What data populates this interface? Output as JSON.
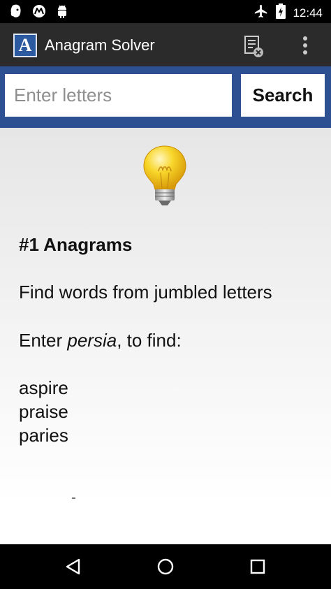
{
  "status_bar": {
    "icons_left": [
      "evernote-icon",
      "motorola-icon",
      "android-icon"
    ],
    "icons_right": [
      "airplane-mode-icon",
      "battery-charging-icon"
    ],
    "time": "12:44"
  },
  "app_bar": {
    "logo_letter": "A",
    "title": "Anagram Solver",
    "actions": [
      "clear-history-icon",
      "overflow-menu-icon"
    ]
  },
  "search": {
    "placeholder": "Enter letters",
    "value": "",
    "button_label": "Search"
  },
  "content": {
    "icon": "lightbulb-icon",
    "heading": "#1 Anagrams",
    "description": "Find words from jumbled letters",
    "example_prefix": "Enter ",
    "example_word": "persia",
    "example_suffix": ", to find:",
    "example_results": [
      "aspire",
      "praise",
      "paries"
    ]
  },
  "nav_bar": {
    "buttons": [
      "back-icon",
      "home-icon",
      "recents-icon"
    ]
  },
  "colors": {
    "status_bar": "#000000",
    "app_bar": "#2b2b2b",
    "search_bar": "#2d5093",
    "logo_blue": "#2c5aa0",
    "nav_bar": "#000000"
  }
}
